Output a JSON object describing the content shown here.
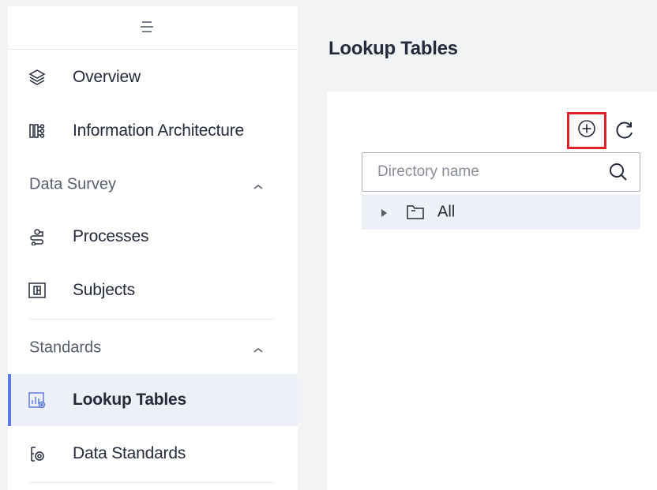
{
  "sidebar": {
    "collapse_icon": "hamburger-icon",
    "items": [
      {
        "label": "Overview",
        "icon": "layers-icon"
      },
      {
        "label": "Information Architecture",
        "icon": "architecture-icon"
      },
      {
        "label": "Processes",
        "icon": "process-icon"
      },
      {
        "label": "Subjects",
        "icon": "subjects-icon"
      },
      {
        "label": "Lookup Tables",
        "icon": "lookup-tables-icon",
        "active": true
      },
      {
        "label": "Data Standards",
        "icon": "data-standards-icon"
      }
    ],
    "groups": [
      {
        "label": "Data Survey",
        "expanded": true
      },
      {
        "label": "Standards",
        "expanded": true
      }
    ]
  },
  "main": {
    "title": "Lookup Tables",
    "toolbar": {
      "add_icon": "add-circle-icon",
      "refresh_icon": "refresh-icon"
    },
    "search": {
      "placeholder": "Directory name",
      "value": ""
    },
    "tree": [
      {
        "label": "All",
        "expanded": false
      }
    ]
  },
  "colors": {
    "accent": "#5e7ce0",
    "highlight_box": "#e0202a",
    "active_bg": "#eef0f8",
    "page_bg": "#f2f3f5"
  }
}
